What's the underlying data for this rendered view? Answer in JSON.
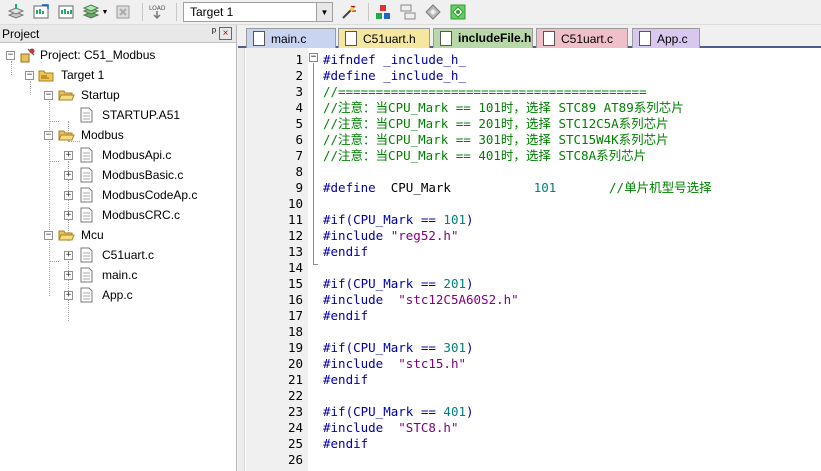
{
  "toolbar": {
    "target_value": "Target 1",
    "icons": [
      "translate-icon",
      "build-icon",
      "rebuild-icon",
      "batch-build-icon",
      "dropdown-arrow-icon",
      "stop-build-icon",
      "download-icon",
      "target-options-icon",
      "manage-components-icon",
      "file-extensions-icon",
      "pack-installer-icon",
      "select-software-packs-icon"
    ]
  },
  "project_panel": {
    "title": "Project",
    "pin_glyph": "ᵖ",
    "close_glyph": "×",
    "tree": [
      {
        "label": "Project: C51_Modbus",
        "kind": "project"
      },
      {
        "label": "Target 1",
        "kind": "target"
      },
      {
        "label": "Startup",
        "kind": "group"
      },
      {
        "label": "STARTUP.A51",
        "kind": "file"
      },
      {
        "label": "Modbus",
        "kind": "group"
      },
      {
        "label": "ModbusApi.c",
        "kind": "file"
      },
      {
        "label": "ModbusBasic.c",
        "kind": "file"
      },
      {
        "label": "ModbusCodeAp.c",
        "kind": "file"
      },
      {
        "label": "ModbusCRC.c",
        "kind": "file"
      },
      {
        "label": "Mcu",
        "kind": "group"
      },
      {
        "label": "C51uart.c",
        "kind": "file"
      },
      {
        "label": "main.c",
        "kind": "file"
      },
      {
        "label": "App.c",
        "kind": "file"
      }
    ]
  },
  "tabs": [
    {
      "label": "main.c",
      "color": "#c8d4f0",
      "active": false
    },
    {
      "label": "C51uart.h",
      "color": "#f5e6a0",
      "active": false
    },
    {
      "label": "includeFile.h",
      "color": "#b8d8a8",
      "active": true
    },
    {
      "label": "C51uart.c",
      "color": "#f0c0c8",
      "active": false
    },
    {
      "label": "App.c",
      "color": "#d8c8f0",
      "active": false
    }
  ],
  "editor": {
    "line_numbers": [
      "1",
      "2",
      "3",
      "4",
      "5",
      "6",
      "7",
      "8",
      "9",
      "10",
      "11",
      "12",
      "13",
      "14",
      "15",
      "16",
      "17",
      "18",
      "19",
      "20",
      "21",
      "22",
      "23",
      "24",
      "25",
      "26"
    ],
    "lines": [
      [
        {
          "t": "#ifndef _include_h_",
          "c": "kw-pp"
        }
      ],
      [
        {
          "t": "#define _include_h_",
          "c": "kw-pp"
        }
      ],
      [
        {
          "t": "//=========================================",
          "c": "cmt"
        }
      ],
      [
        {
          "t": "//注意：当CPU_Mark == 101时，选择 STC89 AT89系列芯片",
          "c": "cmt"
        }
      ],
      [
        {
          "t": "//注意：当CPU_Mark == 201时，选择 STC12C5A系列芯片",
          "c": "cmt"
        }
      ],
      [
        {
          "t": "//注意：当CPU_Mark == 301时，选择 STC15W4K系列芯片",
          "c": "cmt"
        }
      ],
      [
        {
          "t": "//注意：当CPU_Mark == 401时，选择 STC8A系列芯片",
          "c": "cmt"
        }
      ],
      [],
      [
        {
          "t": "#define  ",
          "c": "kw-pp"
        },
        {
          "t": "CPU_Mark",
          "c": "plain"
        },
        {
          "t": "           ",
          "c": "plain"
        },
        {
          "t": "101",
          "c": "num"
        },
        {
          "t": "       ",
          "c": "plain"
        },
        {
          "t": "//单片机型号选择",
          "c": "cmt"
        }
      ],
      [],
      [
        {
          "t": "#if(CPU_Mark == ",
          "c": "kw-pp"
        },
        {
          "t": "101",
          "c": "num"
        },
        {
          "t": ")",
          "c": "kw-pp"
        }
      ],
      [
        {
          "t": "#include ",
          "c": "kw-pp"
        },
        {
          "t": "\"reg52.h\"",
          "c": "str"
        }
      ],
      [
        {
          "t": "#endif",
          "c": "kw-pp"
        }
      ],
      [],
      [
        {
          "t": "#if(CPU_Mark == ",
          "c": "kw-pp"
        },
        {
          "t": "201",
          "c": "num"
        },
        {
          "t": ")",
          "c": "kw-pp"
        }
      ],
      [
        {
          "t": "#include  ",
          "c": "kw-pp"
        },
        {
          "t": "\"stc12C5A60S2.h\"",
          "c": "str"
        }
      ],
      [
        {
          "t": "#endif",
          "c": "kw-pp"
        }
      ],
      [],
      [
        {
          "t": "#if(CPU_Mark == ",
          "c": "kw-pp"
        },
        {
          "t": "301",
          "c": "num"
        },
        {
          "t": ")",
          "c": "kw-pp"
        }
      ],
      [
        {
          "t": "#include  ",
          "c": "kw-pp"
        },
        {
          "t": "\"stc15.h\"",
          "c": "str"
        }
      ],
      [
        {
          "t": "#endif",
          "c": "kw-pp"
        }
      ],
      [],
      [
        {
          "t": "#if(CPU_Mark == ",
          "c": "kw-pp"
        },
        {
          "t": "401",
          "c": "num"
        },
        {
          "t": ")",
          "c": "kw-pp"
        }
      ],
      [
        {
          "t": "#include  ",
          "c": "kw-pp"
        },
        {
          "t": "\"STC8.h\"",
          "c": "str"
        }
      ],
      [
        {
          "t": "#endif",
          "c": "kw-pp"
        }
      ],
      []
    ]
  }
}
